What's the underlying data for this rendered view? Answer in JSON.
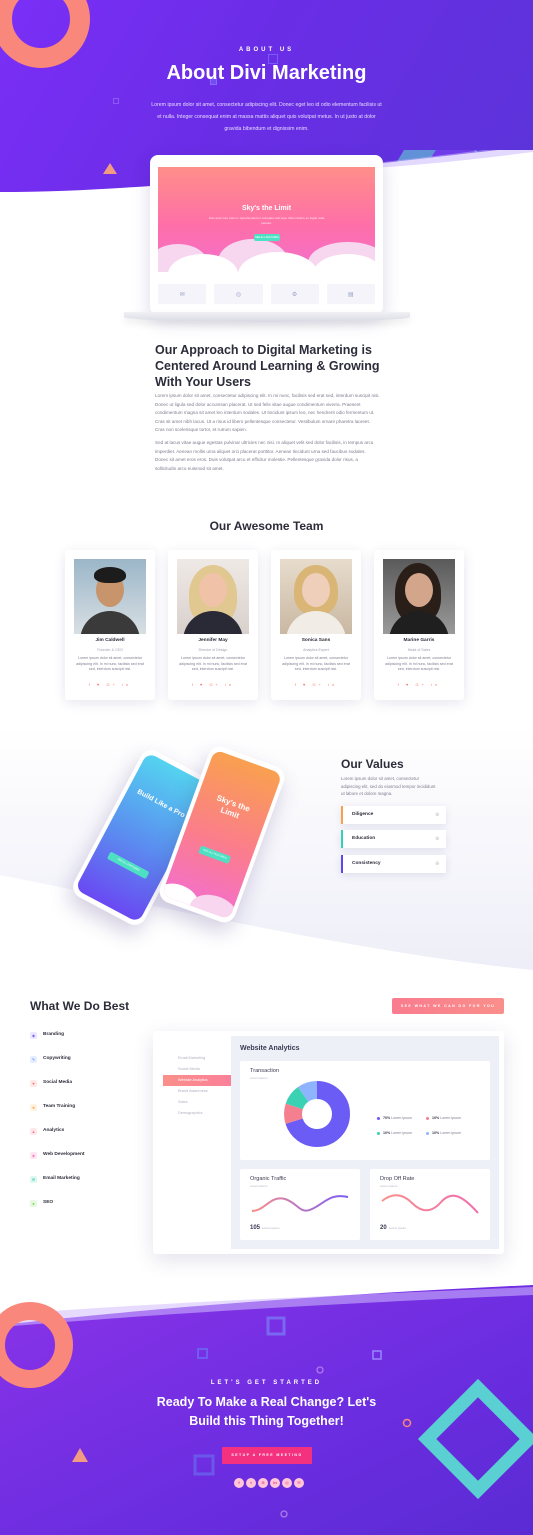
{
  "hero": {
    "eyebrow": "ABOUT US",
    "title": "About Divi Marketing",
    "description": "Lorem ipsum dolor sit amet, consectetur adipiscing elit. Donec eget leo id odio elementum facilisis ut et nulla. Integer consequat enim at massa mattis aliquet quis volutpat metus. In ut justo at dolor gravida bibendum et dignissim enim."
  },
  "laptop": {
    "screen_title": "Sky's the Limit",
    "screen_text": "Duis aute irure dolor in reprehenderit in voluptate velit esse cillum dolore eu fugiat nulla pariatur.",
    "screen_button": "SEE ALL FEATURES",
    "tiles": [
      "✉",
      "◎",
      "⚙",
      "▤"
    ]
  },
  "approach": {
    "title": "Our Approach to Digital Marketing is Centered Around Learning & Growing With Your Users",
    "paragraph1": "Lorem ipsum dolor sit amet, consectetur adipiscing elit. In mi nunc, facilisis sed erat sed, interdum suscipit nisi. Donec ut ligula sed dolor accumsan placerat. Ut sed felis vitae augue condimentum viverra. Praesent condimentum magna sit amet leo interdum sodales. Ut tincidunt ipsum leo, nec hendrerit odio fermentum ut. Cras sit amet nibh lacus. Ut a risus id libero pellentesque consectetur. Vestibulum ornare pharetra laoreet. Cras non scelerisque tortor, et rutrum sapien.",
    "paragraph2": "Sed at lacus vitae augue egestas pulvinar ultricies nec nisi. In aliquet velit sed dolor facilisis, in tempus arcu imperdiet. Aenean mollis urna aliquet orci placerat porttitor. Aenean tincidunt urna sed faucibus sodales. Donec sit amet eros eros. Duis volutpat arcu et efficitur molestie. Pellentesque gravida dolor risus, a sollicitudin arcu euismod sit amet."
  },
  "team": {
    "title": "Our Awesome Team",
    "members": [
      {
        "name": "Jim Caldwell",
        "role": "Founder & CEO",
        "bio": "Lorem ipsum dolor sit amet, consectetur adipiscing elit. In mi nunc, facilisis sed erat sed, interdum suscipit nisi.",
        "social": "f ♥ G+ in"
      },
      {
        "name": "Jennifer May",
        "role": "Director of Design",
        "bio": "Lorem ipsum dolor sit amet, consectetur adipiscing elit. In mi nunc, facilisis sed erat sed, interdum suscipit nisi.",
        "social": "f ♥ G+ in"
      },
      {
        "name": "Sonica Sans",
        "role": "Analytics Expert",
        "bio": "Lorem ipsum dolor sit amet, consectetur adipiscing elit. In mi nunc, facilisis sed erat sed, interdum suscipit nisi.",
        "social": "f ♥ G+ in"
      },
      {
        "name": "Marine Garris",
        "role": "Head of Sales",
        "bio": "Lorem ipsum dolor sit amet, consectetur adipiscing elit. In mi nunc, facilisis sed erat sed, interdum suscipit nisi.",
        "social": "f ♥ G+ in"
      }
    ]
  },
  "values": {
    "phone_left_title": "Build Like a Pro",
    "phone_right_title": "Sky's the Limit",
    "phone_button": "SEE ALL FEATURES",
    "title": "Our Values",
    "description": "Lorem ipsum dolor sit amet, consectetur adipiscing elit, sed do eiusmod tempor incididunt ut labore et dolore magna.",
    "items": [
      {
        "label": "Diligence",
        "color": "#f7a24b"
      },
      {
        "label": "Education",
        "color": "#34d1b6"
      },
      {
        "label": "Consistency",
        "color": "#5a48f0"
      }
    ]
  },
  "best": {
    "title": "What We Do Best",
    "cta": "SEE WHAT WE CAN DO FOR YOU",
    "services": [
      {
        "label": "Branding",
        "icon": "branding-icon",
        "color": "#7e6cf6",
        "bg": "#ece8ff",
        "glyph": "◆"
      },
      {
        "label": "Copywriting",
        "icon": "copywriting-icon",
        "color": "#5b8cf0",
        "bg": "#e6efff",
        "glyph": "✎"
      },
      {
        "label": "Social Media",
        "icon": "social-media-icon",
        "color": "#f47272",
        "bg": "#ffe8e8",
        "glyph": "♥"
      },
      {
        "label": "Team Training",
        "icon": "team-training-icon",
        "color": "#f5a445",
        "bg": "#fff2e2",
        "glyph": "★"
      },
      {
        "label": "Analytics",
        "icon": "analytics-icon",
        "color": "#f47a8a",
        "bg": "#ffe8ec",
        "glyph": "▲"
      },
      {
        "label": "Web Development",
        "icon": "web-development-icon",
        "color": "#ef6fb0",
        "bg": "#ffe6f3",
        "glyph": "◈"
      },
      {
        "label": "Email Marketing",
        "icon": "email-marketing-icon",
        "color": "#2fc2a3",
        "bg": "#ddf7f1",
        "glyph": "✉"
      },
      {
        "label": "SEO",
        "icon": "seo-icon",
        "color": "#6ccf52",
        "bg": "#e6f8df",
        "glyph": "●"
      }
    ]
  },
  "dashboard": {
    "sidebar": [
      "Email Marketing",
      "Social Media",
      "Website Analytics",
      "Brand Awareness",
      "Sales",
      "Demographics"
    ],
    "active_index": 2,
    "title": "Website Analytics",
    "transaction": {
      "title": "Transaction",
      "subtitle": "Lorem ipsum",
      "legend": [
        {
          "value": "70%",
          "text": "Lorem ipsum",
          "color": "#6b5cf5"
        },
        {
          "value": "10%",
          "text": "Lorem ipsum",
          "color": "#f47f8f"
        },
        {
          "value": "10%",
          "text": "Lorem ipsum",
          "color": "#3bd1b3"
        },
        {
          "value": "10%",
          "text": "Lorem ipsum",
          "color": "#8fb4ff"
        }
      ]
    },
    "organic": {
      "title": "Organic Traffic",
      "subtitle": "Lorem ipsum",
      "value": "105",
      "value_label": "Lorem ipsum"
    },
    "dropoff": {
      "title": "Drop Off Rate",
      "subtitle": "Lorem ipsum",
      "value": "20",
      "value_label": "Lorem ipsum"
    }
  },
  "footer": {
    "eyebrow": "LET'S GET STARTED",
    "title_line1": "Ready To Make a Real Change? Let's",
    "title_line2": "Build this Thing Together!",
    "button": "SETUP A FREE MEETING",
    "social": [
      "f",
      "t",
      "G",
      "in",
      "◎",
      "✉"
    ]
  }
}
